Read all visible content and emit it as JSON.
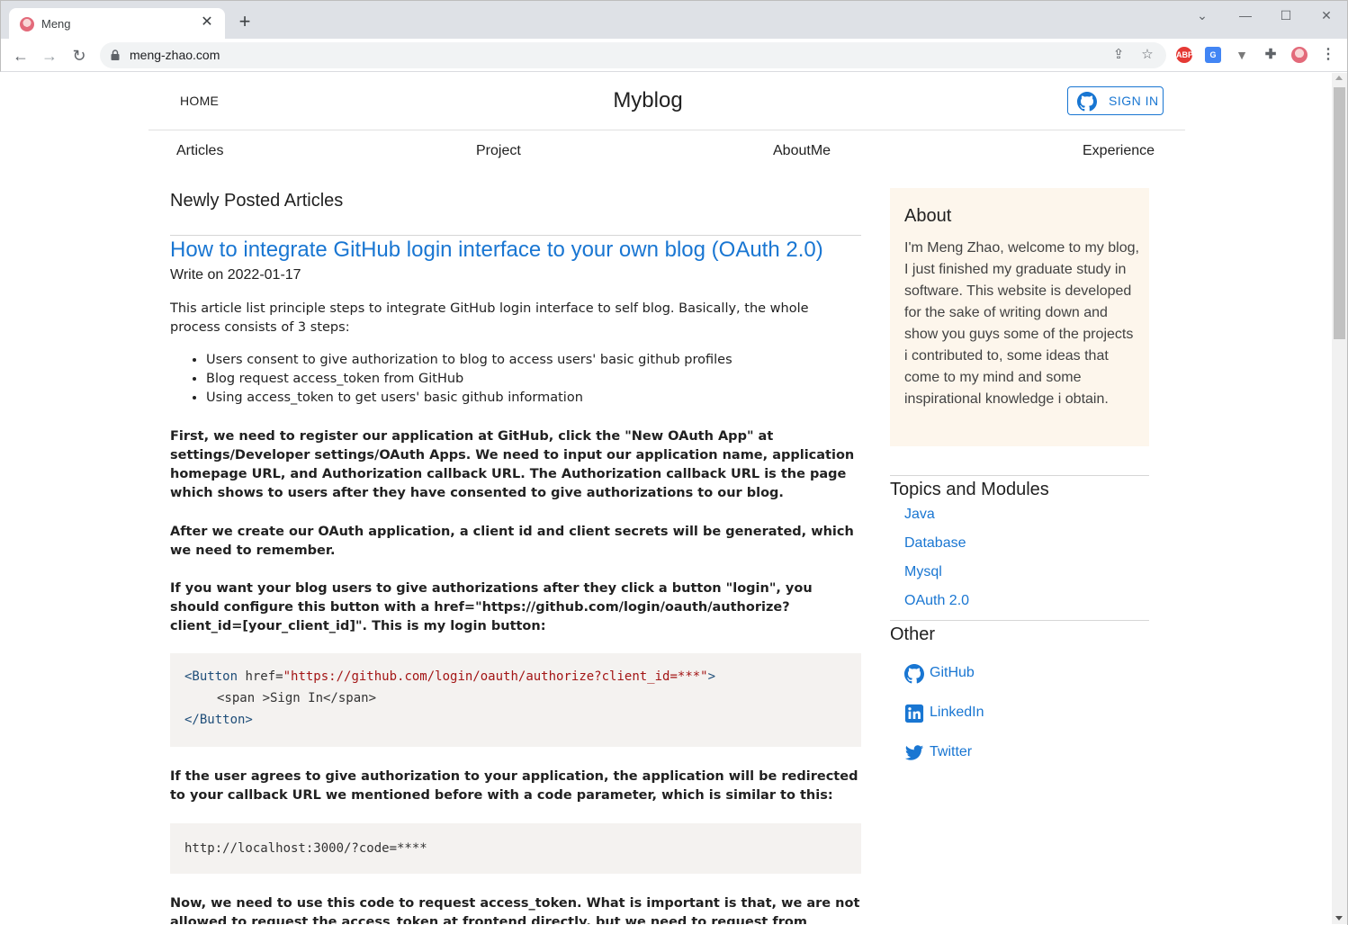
{
  "browser": {
    "tab_title": "Meng",
    "url": "meng-zhao.com"
  },
  "header": {
    "home": "HOME",
    "site_title": "Myblog",
    "signin": "SIGN IN"
  },
  "nav": {
    "articles": "Articles",
    "project": "Project",
    "aboutme": "AboutMe",
    "experience": "Experience"
  },
  "main": {
    "section_title": "Newly Posted Articles",
    "article": {
      "title": "How to integrate GitHub login interface to your own blog (OAuth 2.0)",
      "date": "Write on 2022-01-17",
      "intro": "This article list principle steps to integrate GitHub login interface to self blog. Basically, the whole process consists of 3 steps:",
      "steps": [
        "Users consent to give authorization to blog to access users' basic github profiles",
        "Blog request access_token from GitHub",
        "Using access_token to get users' basic github information"
      ],
      "para1": "First, we need to register our application at GitHub, click the \"New OAuth App\" at settings/Developer settings/OAuth Apps. We need to input our application name, application homepage URL, and Authorization callback URL. The Authorization callback URL is the page which shows to users after they have consented to give authorizations to our blog.",
      "para2": "After we create our OAuth application, a client id and client secrets will be generated, which we need to remember.",
      "para3": "If you want your blog users to give authorizations after they click a button \"login\", you should configure this button with a href=\"https://github.com/login/oauth/authorize?client_id=[your_client_id]\". This is my login button:",
      "code1": {
        "line1_tag": "<Button",
        "line1_attr": " href=",
        "line1_url": "\"https://github.com/login/oauth/authorize?client_id=***\"",
        "line1_end": ">",
        "line2": "<span >Sign In</span>",
        "line3": "</Button>"
      },
      "para4": "If the user agrees to give authorization to your application, the application will be redirected to your callback URL we mentioned before with a code parameter, which is similar to this:",
      "code2": "http://localhost:3000/?code=****",
      "para5": "Now, we need to use this code to request access_token. What is important is that, we are not allowed to request the access_token at frontend directly, but we need to request from backend. The reason is"
    }
  },
  "sidebar": {
    "about_title": "About",
    "about_text": "I'm Meng Zhao, welcome to my blog, I just finished my graduate study in software. This website is developed for the sake of writing down and show you guys some of the projects i contributed to, some ideas that come to my mind and some inspirational knowledge i obtain.",
    "topics_title": "Topics and Modules",
    "topics": [
      "Java",
      "Database",
      "Mysql",
      "OAuth 2.0"
    ],
    "other_title": "Other",
    "other": [
      "GitHub",
      "LinkedIn",
      "Twitter"
    ]
  },
  "colors": {
    "accent": "#1976d2",
    "about_bg": "#fdf6ec",
    "code_bg": "#f4f2f0"
  }
}
